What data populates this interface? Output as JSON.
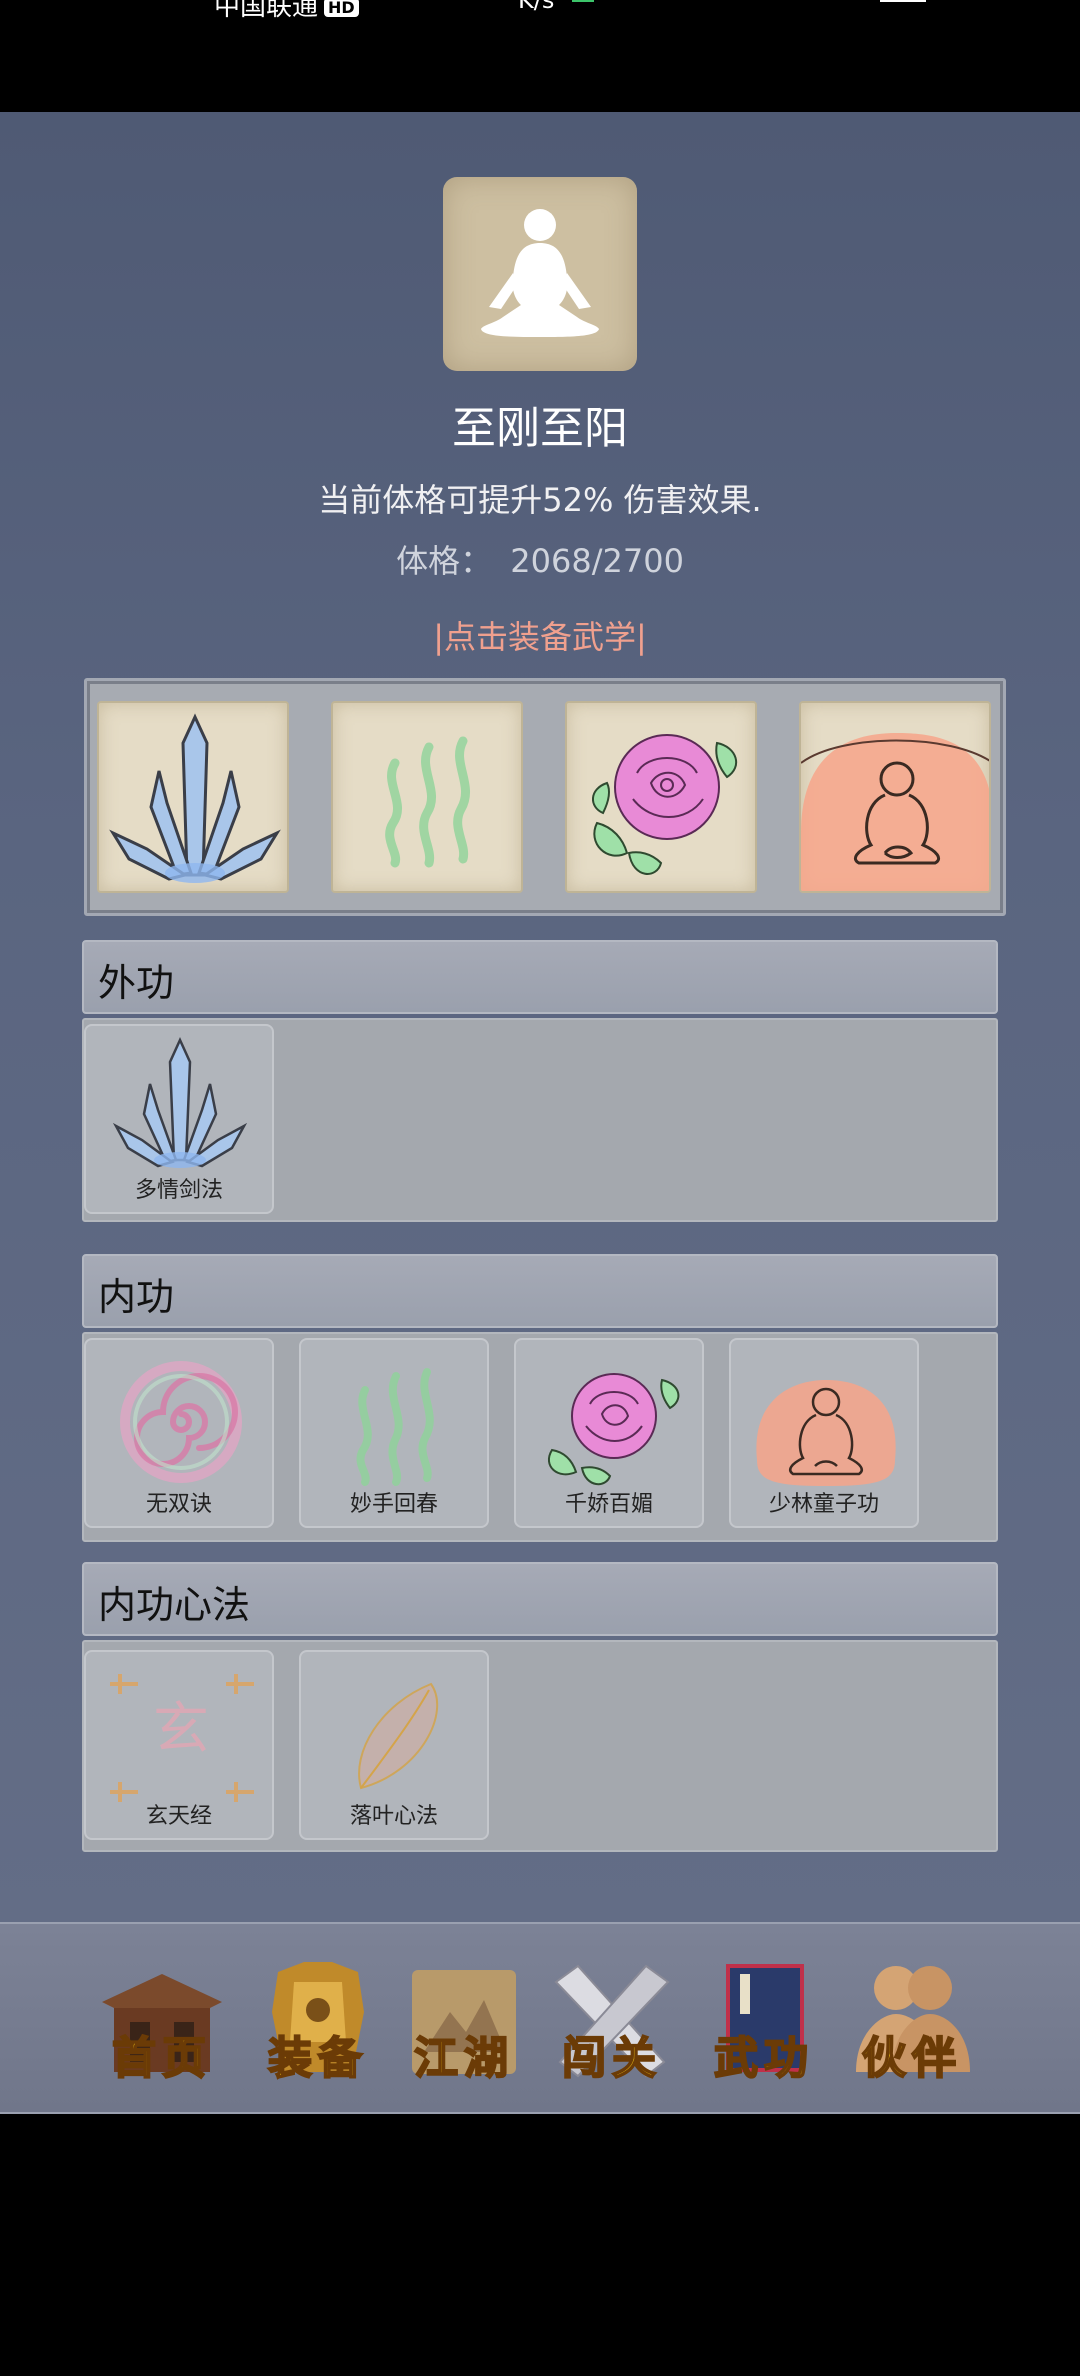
{
  "status_bar": {
    "carrier": "中国联通",
    "hd": "HD",
    "speed": "K/s"
  },
  "header": {
    "title": "至刚至阳",
    "description": "当前体格可提升52% 伤害效果.",
    "stat_label": "体格：",
    "stat_value": "2068/2700",
    "equip_prompt": "|点击装备武学|"
  },
  "sections": {
    "outer": {
      "title": "外功",
      "skills": [
        "多情剑法"
      ]
    },
    "inner": {
      "title": "内功",
      "skills": [
        "无双诀",
        "妙手回春",
        "千娇百媚",
        "少林童子功"
      ]
    },
    "mind": {
      "title": "内功心法",
      "skills": [
        "玄天经",
        "落叶心法"
      ],
      "glyph": "玄"
    }
  },
  "nav": {
    "items": [
      "首页",
      "装备",
      "江湖",
      "闯关",
      "武功",
      "伙伴"
    ],
    "active": "武功"
  },
  "colors": {
    "accent": "#f0a08e",
    "nav_text": "#f3c417"
  }
}
